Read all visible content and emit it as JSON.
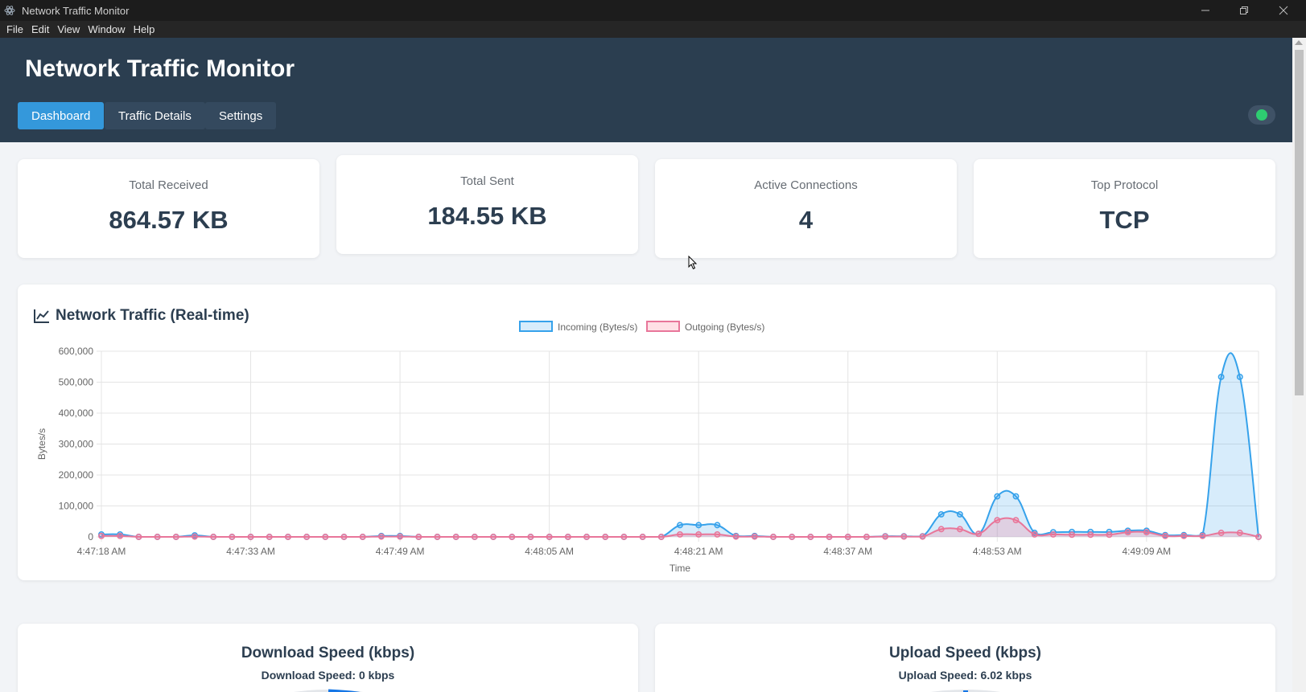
{
  "window": {
    "title": "Network Traffic Monitor",
    "controls": [
      "minimize",
      "restore",
      "close"
    ]
  },
  "menu": [
    "File",
    "Edit",
    "View",
    "Window",
    "Help"
  ],
  "header": {
    "title": "Network Traffic Monitor",
    "tabs": [
      {
        "label": "Dashboard",
        "active": true
      },
      {
        "label": "Traffic Details",
        "active": false
      },
      {
        "label": "Settings",
        "active": false
      }
    ],
    "status_color": "#2ecc71"
  },
  "stats": [
    {
      "label": "Total Received",
      "value": "864.57 KB"
    },
    {
      "label": "Total Sent",
      "value": "184.55 KB"
    },
    {
      "label": "Active Connections",
      "value": "4"
    },
    {
      "label": "Top Protocol",
      "value": "TCP"
    }
  ],
  "traffic_panel": {
    "title": "Network Traffic (Real-time)",
    "icon": "line-chart-icon"
  },
  "chart_data": {
    "type": "line",
    "fill": true,
    "xlabel": "Time",
    "ylabel": "Bytes/s",
    "ylim": [
      0,
      600000
    ],
    "yticks": [
      0,
      100000,
      200000,
      300000,
      400000,
      500000,
      600000
    ],
    "ytick_labels": [
      "0",
      "100,000",
      "200,000",
      "300,000",
      "400,000",
      "500,000",
      "600,000"
    ],
    "xtick_labels": [
      "4:47:18 AM",
      "4:47:33 AM",
      "4:47:49 AM",
      "4:48:05 AM",
      "4:48:21 AM",
      "4:48:37 AM",
      "4:48:53 AM",
      "4:49:09 AM"
    ],
    "xtick_index": [
      0,
      8,
      16,
      24,
      32,
      40,
      48,
      56
    ],
    "legend_position": "top",
    "grid": true,
    "series": [
      {
        "name": "Incoming (Bytes/s)",
        "color": "#36a2eb",
        "fill": "rgba(54,162,235,0.2)",
        "values": [
          8000,
          8000,
          0,
          0,
          0,
          5000,
          0,
          0,
          0,
          0,
          0,
          0,
          0,
          0,
          0,
          3000,
          3000,
          0,
          0,
          0,
          0,
          0,
          0,
          0,
          0,
          0,
          0,
          0,
          0,
          0,
          0,
          38000,
          38000,
          38000,
          3000,
          3000,
          0,
          0,
          0,
          0,
          0,
          0,
          2000,
          2000,
          2000,
          73000,
          73000,
          10000,
          131000,
          131000,
          13000,
          15000,
          16000,
          16000,
          16000,
          20000,
          20000,
          6000,
          6000,
          6000,
          517000,
          517000,
          0
        ]
      },
      {
        "name": "Outgoing (Bytes/s)",
        "color": "#e8769a",
        "fill": "rgba(255,99,132,0.2)",
        "values": [
          3000,
          3000,
          0,
          0,
          0,
          1000,
          0,
          0,
          0,
          0,
          0,
          0,
          0,
          0,
          0,
          1000,
          1000,
          0,
          0,
          0,
          0,
          0,
          0,
          0,
          0,
          0,
          0,
          0,
          0,
          0,
          0,
          8000,
          8000,
          8000,
          1000,
          1000,
          0,
          0,
          0,
          0,
          0,
          0,
          1000,
          1000,
          1000,
          25000,
          25000,
          10000,
          54000,
          54000,
          8000,
          8000,
          7000,
          7000,
          7000,
          15000,
          15000,
          3000,
          3000,
          3000,
          13000,
          13000,
          0
        ]
      }
    ]
  },
  "speed_panels": [
    {
      "title": "Download Speed (kbps)",
      "subtitle": "Download Speed: 0 kbps",
      "value_kbps": 0
    },
    {
      "title": "Upload Speed (kbps)",
      "subtitle": "Upload Speed: 6.02 kbps",
      "value_kbps": 6.02
    }
  ],
  "colors": {
    "header_bg": "#2b3e50",
    "tab_active": "#3498db",
    "gauge": "#1677e6"
  }
}
